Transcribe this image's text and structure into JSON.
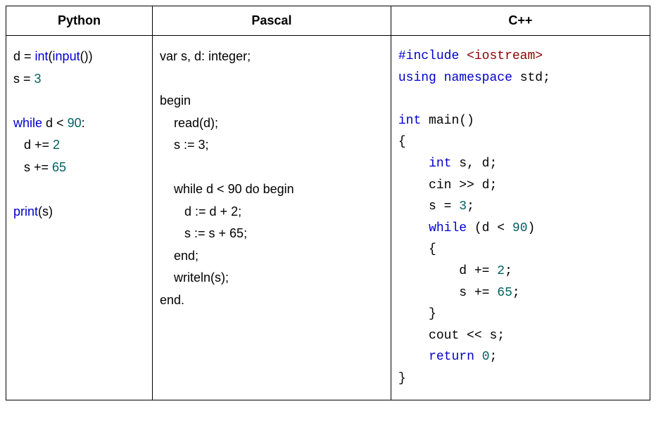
{
  "headers": {
    "python": "Python",
    "pascal": "Pascal",
    "cpp": "C++"
  },
  "python": {
    "l1a": "d = ",
    "l1b": "int",
    "l1c": "(",
    "l1d": "input",
    "l1e": "())",
    "l2a": "s = ",
    "l2b": "3",
    "l3a": "while",
    "l3b": " d < ",
    "l3c": "90",
    "l3d": ":",
    "l4a": "   d += ",
    "l4b": "2",
    "l5a": "   s += ",
    "l5b": "65",
    "l6": "print",
    "l6b": "(s)"
  },
  "pascal": {
    "l1": "var s, d: integer;",
    "l2": "begin",
    "l3": "    read(d);",
    "l4": "    s := 3;",
    "l5": "    while d < 90 do begin",
    "l6": "       d := d + 2;",
    "l7": "       s := s + 65;",
    "l8": "    end;",
    "l9": "    writeln(s);",
    "l10": "end."
  },
  "cpp": {
    "l1a": "#include ",
    "l1b": "<iostream>",
    "l2a": "using",
    "l2b": " namespace",
    "l2c": " std;",
    "l3a": "int",
    "l3b": " main()",
    "l4": "{",
    "l5a": "    ",
    "l5b": "int",
    "l5c": " s, d;",
    "l6": "    cin >> d;",
    "l7a": "    s = ",
    "l7b": "3",
    "l7c": ";",
    "l8a": "    ",
    "l8b": "while",
    "l8c": " (d < ",
    "l8d": "90",
    "l8e": ")",
    "l9": "    {",
    "l10a": "        d += ",
    "l10b": "2",
    "l10c": ";",
    "l11a": "        s += ",
    "l11b": "65",
    "l11c": ";",
    "l12": "    }",
    "l13": "    cout << s;",
    "l14a": "    ",
    "l14b": "return",
    "l14c": " ",
    "l14d": "0",
    "l14e": ";",
    "l15": "}"
  }
}
